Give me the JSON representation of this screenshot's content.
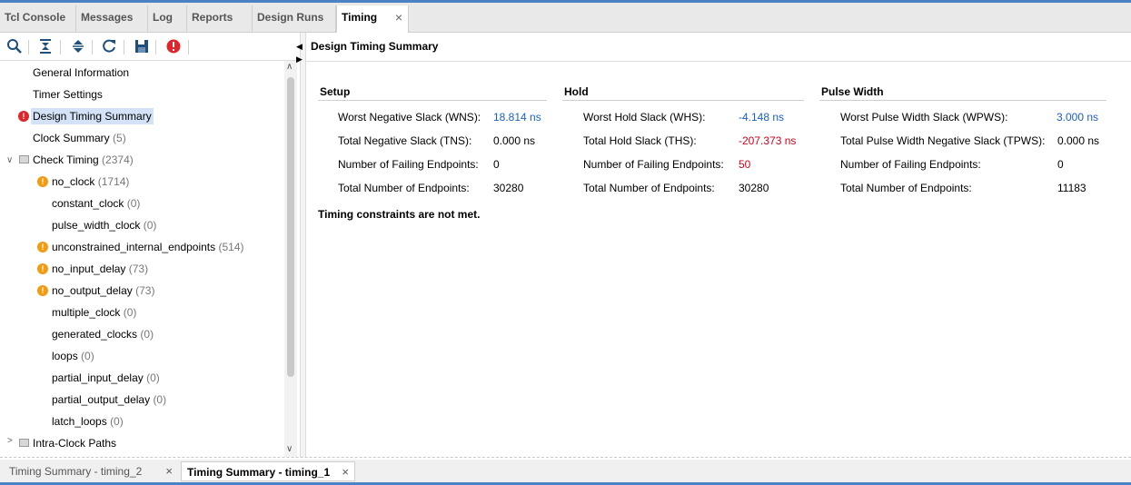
{
  "tabs": [
    {
      "label": "Tcl Console"
    },
    {
      "label": "Messages"
    },
    {
      "label": "Log"
    },
    {
      "label": "Reports"
    },
    {
      "label": "Design Runs"
    },
    {
      "label": "Timing",
      "active": true,
      "close": "×"
    }
  ],
  "toolbar": {
    "icons": [
      "search-icon",
      "collapse-all-icon",
      "expand-all-icon",
      "refresh-icon",
      "save-icon",
      "error-filter-icon"
    ]
  },
  "tree": {
    "general_information": "General Information",
    "timer_settings": "Timer Settings",
    "design_timing_summary": "Design Timing Summary",
    "clock_summary": {
      "label": "Clock Summary",
      "count": "(5)"
    },
    "check_timing": {
      "label": "Check Timing",
      "count": "(2374)"
    },
    "children": [
      {
        "label": "no_clock",
        "count": "(1714)",
        "warn": true
      },
      {
        "label": "constant_clock",
        "count": "(0)"
      },
      {
        "label": "pulse_width_clock",
        "count": "(0)"
      },
      {
        "label": "unconstrained_internal_endpoints",
        "count": "(514)",
        "warn": true
      },
      {
        "label": "no_input_delay",
        "count": "(73)",
        "warn": true
      },
      {
        "label": "no_output_delay",
        "count": "(73)",
        "warn": true
      },
      {
        "label": "multiple_clock",
        "count": "(0)"
      },
      {
        "label": "generated_clocks",
        "count": "(0)"
      },
      {
        "label": "loops",
        "count": "(0)"
      },
      {
        "label": "partial_input_delay",
        "count": "(0)"
      },
      {
        "label": "partial_output_delay",
        "count": "(0)"
      },
      {
        "label": "latch_loops",
        "count": "(0)"
      }
    ],
    "intra_clock_paths": "Intra-Clock Paths"
  },
  "panel": {
    "title": "Design Timing Summary",
    "setup": {
      "title": "Setup",
      "rows": [
        {
          "label": "Worst Negative Slack (WNS):",
          "value": "18.814 ns",
          "color": "#1a5fc9"
        },
        {
          "label": "Total Negative Slack (TNS):",
          "value": "0.000 ns"
        },
        {
          "label": "Number of Failing Endpoints:",
          "value": "0"
        },
        {
          "label": "Total Number of Endpoints:",
          "value": "30280"
        }
      ]
    },
    "hold": {
      "title": "Hold",
      "rows": [
        {
          "label": "Worst Hold Slack (WHS):",
          "value": "-4.148 ns",
          "color": "#1a5fc9"
        },
        {
          "label": "Total Hold Slack (THS):",
          "value": "-207.373 ns",
          "color": "#d0021b"
        },
        {
          "label": "Number of Failing Endpoints:",
          "value": "50",
          "color": "#d0021b"
        },
        {
          "label": "Total Number of Endpoints:",
          "value": "30280"
        }
      ]
    },
    "pulse_width": {
      "title": "Pulse Width",
      "rows": [
        {
          "label": "Worst Pulse Width Slack (WPWS):",
          "value": "3.000 ns",
          "color": "#1a5fc9"
        },
        {
          "label": "Total Pulse Width Negative Slack (TPWS):",
          "value": "0.000 ns"
        },
        {
          "label": "Number of Failing Endpoints:",
          "value": "0"
        },
        {
          "label": "Total Number of Endpoints:",
          "value": "11183"
        }
      ]
    },
    "verdict": "Timing constraints are not met."
  },
  "bottom_tabs": [
    {
      "label": "Timing Summary - timing_2",
      "close": "×"
    },
    {
      "label": "Timing Summary - timing_1",
      "close": "×",
      "active": true
    }
  ]
}
